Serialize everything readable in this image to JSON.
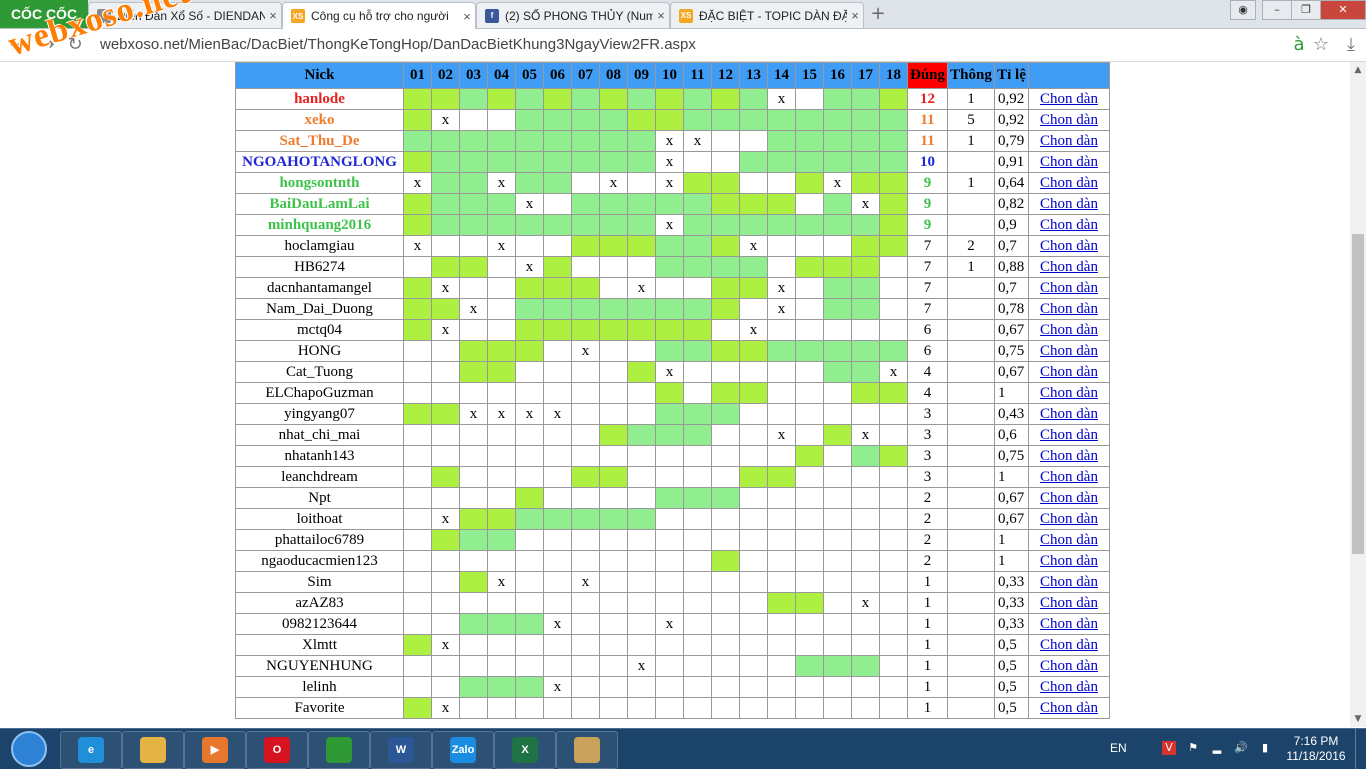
{
  "browser": {
    "logo": "CỐC CỐC",
    "tabs": [
      {
        "title": "Diễn Đàn Xổ Số - DIENDAN",
        "icon": "page-icon",
        "active": false
      },
      {
        "title": "Công cụ hỗ trợ cho người",
        "icon": "xs-icon",
        "active": true
      },
      {
        "title": "(2) SỐ PHONG THỦY (Num",
        "icon": "facebook-icon",
        "active": false
      },
      {
        "title": "ĐẶC BIỆT - TOPIC DÀN ĐẶ",
        "icon": "xs-icon",
        "active": false
      }
    ],
    "new_tab": "+",
    "url": "webxoso.net/MienBac/DacBiet/ThongKeTongHop/DanDacBietKhung3NgayView2FR.aspx",
    "watermark": "webxoso.net"
  },
  "table": {
    "headers": {
      "nick": "Nick",
      "days": [
        "01",
        "02",
        "03",
        "04",
        "05",
        "06",
        "07",
        "08",
        "09",
        "10",
        "11",
        "12",
        "13",
        "14",
        "15",
        "16",
        "17",
        "18"
      ],
      "dung": "Đúng",
      "thong": "Thông",
      "tile": "Tỉ lệ"
    },
    "link_label": "Chon dàn",
    "colors": {
      "header": "#3f9df5",
      "dung_header": "#ff0000",
      "hit_green": "#adf042",
      "light_green": "#90ee90"
    },
    "rows": [
      {
        "nick": "hanlode",
        "color": "#e8201e",
        "bold": true,
        "cells": "1121212121212x0221",
        "dung": "12",
        "thong": "1",
        "tile": "0,92"
      },
      {
        "nick": "xeko",
        "color": "#f07b2c",
        "bold": true,
        "cells": "1x0022221122222222",
        "dung": "11",
        "thong": "5",
        "tile": "0,92"
      },
      {
        "nick": "Sat_Thu_De",
        "color": "#f07b2c",
        "bold": true,
        "cells": "222222222xx0022222",
        "dung": "11",
        "thong": "1",
        "tile": "0,79"
      },
      {
        "nick": "NGOAHOTANGLONG",
        "color": "#1f27d6",
        "bold": true,
        "cells": "122222222x00222222",
        "dung": "10",
        "thong": "",
        "tile": "0,91"
      },
      {
        "nick": "hongsontnth",
        "color": "#3ec24a",
        "bold": true,
        "cells": "x22x220x0x11001x11",
        "dung": "9",
        "thong": "1",
        "tile": "0,64"
      },
      {
        "nick": "BaiDauLamLai",
        "color": "#3ec24a",
        "bold": true,
        "cells": "1222x02222211102x1",
        "dung": "9",
        "thong": "",
        "tile": "0,82"
      },
      {
        "nick": "minhquang2016",
        "color": "#3ec24a",
        "bold": true,
        "cells": "122222222x22222221",
        "dung": "9",
        "thong": "",
        "tile": "0,9"
      },
      {
        "nick": "hoclamgiau",
        "color": "#000",
        "bold": false,
        "cells": "x00x00111221x00011",
        "dung": "7",
        "thong": "2",
        "tile": "0,7"
      },
      {
        "nick": "HB6274",
        "color": "#000",
        "bold": false,
        "cells": "0110x100022220111",
        "dung": "7",
        "thong": "1",
        "tile": "0,88"
      },
      {
        "nick": "dacnhantamangel",
        "color": "#000",
        "bold": false,
        "cells": "1x001110x0011x0220",
        "dung": "7",
        "thong": "",
        "tile": "0,7"
      },
      {
        "nick": "Nam_Dai_Duong",
        "color": "#000",
        "bold": false,
        "cells": "11x0222222210x0220",
        "dung": "7",
        "thong": "",
        "tile": "0,78"
      },
      {
        "nick": "mctq04",
        "color": "#000",
        "bold": false,
        "cells": "1x0011111110x00000",
        "dung": "6",
        "thong": "",
        "tile": "0,67"
      },
      {
        "nick": "HONG",
        "color": "#000",
        "bold": false,
        "cells": "001110x00221122222x",
        "dung": "6",
        "thong": "",
        "tile": "0,75"
      },
      {
        "nick": "Cat_Tuong",
        "color": "#000",
        "bold": false,
        "cells": "001100001x0000022x",
        "dung": "4",
        "thong": "",
        "tile": "0,67"
      },
      {
        "nick": "ELChapoGuzman",
        "color": "#000",
        "bold": false,
        "cells": "000000000101100011",
        "dung": "4",
        "thong": "",
        "tile": "1"
      },
      {
        "nick": "yingyang07",
        "color": "#000",
        "bold": false,
        "cells": "11xxxx000222000000",
        "dung": "3",
        "thong": "",
        "tile": "0,43"
      },
      {
        "nick": "nhat_chi_mai",
        "color": "#000",
        "bold": false,
        "cells": "0000000122200x01x00",
        "dung": "3",
        "thong": "",
        "tile": "0,6"
      },
      {
        "nick": "nhatanh143",
        "color": "#000",
        "bold": false,
        "cells": "000000000000001021",
        "dung": "3",
        "thong": "",
        "tile": "0,75"
      },
      {
        "nick": "leanchdream",
        "color": "#000",
        "bold": false,
        "cells": "010000110000110000",
        "dung": "3",
        "thong": "",
        "tile": "1"
      },
      {
        "nick": "Npt",
        "color": "#000",
        "bold": false,
        "cells": "000010000222000000x",
        "dung": "2",
        "thong": "",
        "tile": "0,67"
      },
      {
        "nick": "loithoat",
        "color": "#000",
        "bold": false,
        "cells": "0x1122222000000000",
        "dung": "2",
        "thong": "",
        "tile": "0,67"
      },
      {
        "nick": "phattailoc6789",
        "color": "#000",
        "bold": false,
        "cells": "012200000000000000",
        "dung": "2",
        "thong": "",
        "tile": "1"
      },
      {
        "nick": "ngaoducacmien123",
        "color": "#000",
        "bold": false,
        "cells": "000000000001000000",
        "dung": "2",
        "thong": "",
        "tile": "1"
      },
      {
        "nick": "Sim",
        "color": "#000",
        "bold": false,
        "cells": "001x00x00000000000",
        "dung": "1",
        "thong": "",
        "tile": "0,33"
      },
      {
        "nick": "azAZ83",
        "color": "#000",
        "bold": false,
        "cells": "0000000000000110x0",
        "dung": "1",
        "thong": "",
        "tile": "0,33"
      },
      {
        "nick": "0982123644",
        "color": "#000",
        "bold": false,
        "cells": "00222x000x00000000",
        "dung": "1",
        "thong": "",
        "tile": "0,33"
      },
      {
        "nick": "Xlmtt",
        "color": "#000",
        "bold": false,
        "cells": "1x0000000000000000",
        "dung": "1",
        "thong": "",
        "tile": "0,5"
      },
      {
        "nick": "NGUYENHUNG",
        "color": "#000",
        "bold": false,
        "cells": "00000000x00000222000",
        "dung": "1",
        "thong": "",
        "tile": "0,5"
      },
      {
        "nick": "lelinh",
        "color": "#000",
        "bold": false,
        "cells": "00222x000000000000",
        "dung": "1",
        "thong": "",
        "tile": "0,5"
      },
      {
        "nick": "Favorite",
        "color": "#000",
        "bold": false,
        "cells": "1x0000000000000000",
        "dung": "1",
        "thong": "",
        "tile": "0,5"
      }
    ]
  },
  "taskbar": {
    "apps": [
      {
        "icon": "ie-icon",
        "label": "e",
        "color": "#1e8fd8"
      },
      {
        "icon": "explorer-icon",
        "label": "",
        "color": "#e3b444"
      },
      {
        "icon": "media-player-icon",
        "label": "▶",
        "color": "#e8772e"
      },
      {
        "icon": "opera-icon",
        "label": "O",
        "color": "#d6141f"
      },
      {
        "icon": "coccoc-icon",
        "label": "",
        "color": "#2f9a35"
      },
      {
        "icon": "word-icon",
        "label": "W",
        "color": "#2b5797"
      },
      {
        "icon": "zalo-icon",
        "label": "Zalo",
        "color": "#1a8de0"
      },
      {
        "icon": "excel-icon",
        "label": "X",
        "color": "#1f7244"
      },
      {
        "icon": "paint-icon",
        "label": "",
        "color": "#c9a35b"
      }
    ],
    "language": "EN",
    "time": "7:16 PM",
    "date": "11/18/2016"
  }
}
